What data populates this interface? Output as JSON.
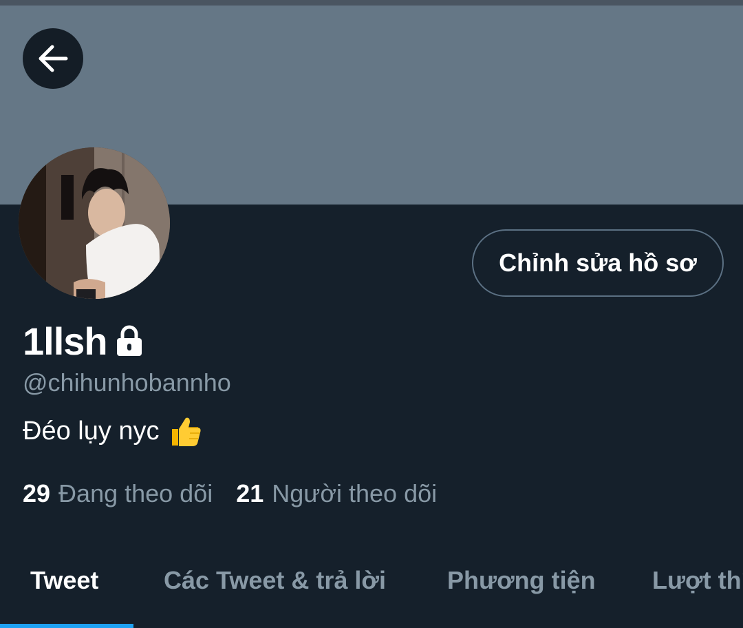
{
  "profile": {
    "display_name": "1llsh",
    "handle": "@chihunhobannho",
    "bio": "Đéo lụy nyc",
    "bio_emoji": "thumbs-up-icon",
    "locked": true
  },
  "actions": {
    "edit_profile_label": "Chỉnh sửa hồ sơ"
  },
  "stats": {
    "following_count": "29",
    "following_label": "Đang theo dõi",
    "followers_count": "21",
    "followers_label": "Người theo dõi"
  },
  "tabs": [
    {
      "label": "Tweet",
      "active": true
    },
    {
      "label": "Các Tweet & trả lời",
      "active": false
    },
    {
      "label": "Phương tiện",
      "active": false
    },
    {
      "label": "Lượt thích",
      "active": false
    }
  ],
  "colors": {
    "background": "#15202b",
    "banner": "#657786",
    "accent": "#1da1f2",
    "secondary_text": "#8899a6"
  }
}
